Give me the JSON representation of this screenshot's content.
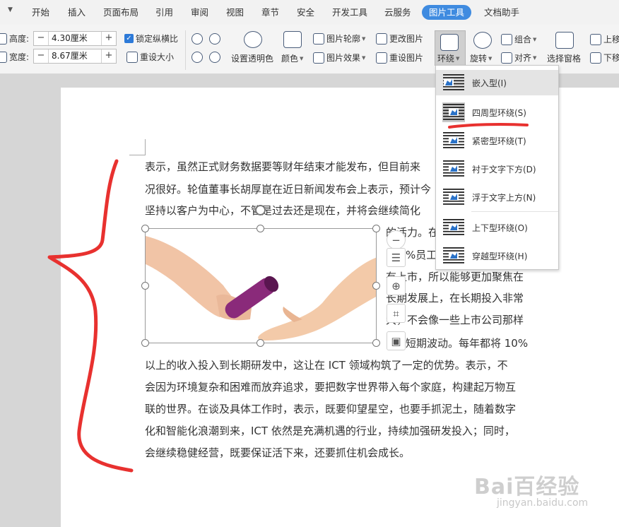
{
  "tabs": [
    "开始",
    "插入",
    "页面布局",
    "引用",
    "审阅",
    "视图",
    "章节",
    "安全",
    "开发工具",
    "云服务",
    "图片工具",
    "文档助手"
  ],
  "ribbon": {
    "height_label": "高度:",
    "height_value": "4.30厘米",
    "width_label": "宽度:",
    "width_value": "8.67厘米",
    "minus": "−",
    "plus": "+",
    "lock_ratio": "锁定纵横比",
    "reset_size": "重设大小",
    "set_transparent": "设置透明色",
    "color": "颜色",
    "outline": "图片轮廓",
    "effects": "图片效果",
    "change_picture": "更改图片",
    "reset_picture": "重设图片",
    "wrap": "环绕",
    "rotate": "旋转",
    "group": "组合",
    "align": "对齐",
    "selection_pane": "选择窗格",
    "bring_up": "上移",
    "send_down": "下移"
  },
  "wrap_menu": [
    "嵌入型(I)",
    "四周型环绕(S)",
    "紧密型环绕(T)",
    "衬于文字下方(D)",
    "浮于文字上方(N)",
    "上下型环绕(O)",
    "穿越型环绕(H)"
  ],
  "doc_lines": [
    "表示，虽然正式财务数据要等财年结束才能发布，但目前来",
    "况很好。轮值董事长胡厚崑在近日新闻发布会上表示，预计今",
    "坚持以客户为中心，不管是过去还是现在，并将会继续简化",
    "的活力。在",
    "%员工",
    "有上市，所以能够更加聚焦在",
    "长期发展上，在长期投入非常",
    "大，不会像一些上市公司那样",
    "短期波动。每年都将 10%",
    "以上的收入投入到长期研发中，这让在 ICT 领域构筑了一定的优势。表示，不",
    "会因为环境复杂和困难而放弃追求，要把数字世界带入每个家庭，构建起万物互",
    "联的世界。在谈及具体工作时，表示，既要仰望星空，也要手抓泥土，随着数字",
    "化和智能化浪潮到来，ICT 依然是充满机遇的行业，持续加强研发投入；同时，",
    "会继续稳健经营，既要保证活下来，还要抓住机会成长。"
  ],
  "watermark": {
    "brand": "Bai百经验",
    "url": "jingyan.baidu.com"
  },
  "colors": {
    "active_tab": "#3f8be0",
    "annotation": "#e8312f",
    "menu_icon_blue": "#2a72c8"
  }
}
